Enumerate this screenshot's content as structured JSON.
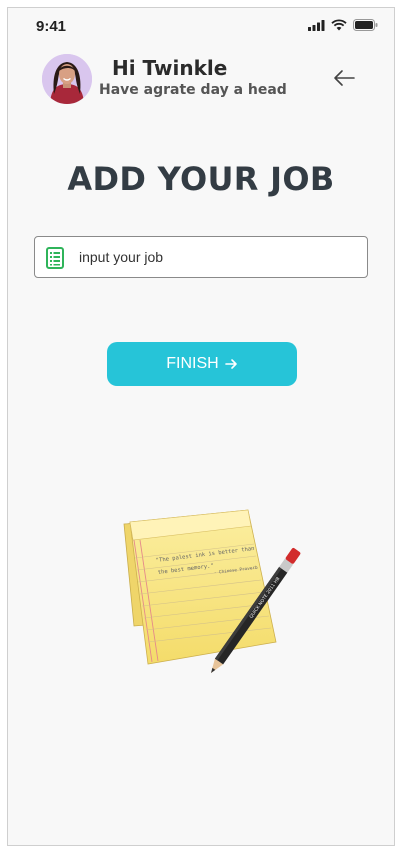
{
  "status_bar": {
    "time": "9:41"
  },
  "header": {
    "greeting": "Hi Twinkle",
    "subtitle": "Have agrate day a head",
    "back_icon": "arrow-left-icon"
  },
  "main": {
    "title": "ADD YOUR JOB",
    "job_input": {
      "placeholder": "input your job",
      "value": "",
      "icon": "document-list-icon"
    },
    "finish_button": {
      "label": "FINISH",
      "icon": "arrow-right-icon"
    }
  },
  "illustration": {
    "quote_line1": "\"The palest ink is better than",
    "quote_line2": "the best memory.\"",
    "attribution": "- Chinese Proverb",
    "pencil_text": "QUICK NOTE  2011 HB"
  },
  "colors": {
    "accent": "#26c4d8",
    "title": "#333c44",
    "input_icon": "#2fb45a"
  }
}
